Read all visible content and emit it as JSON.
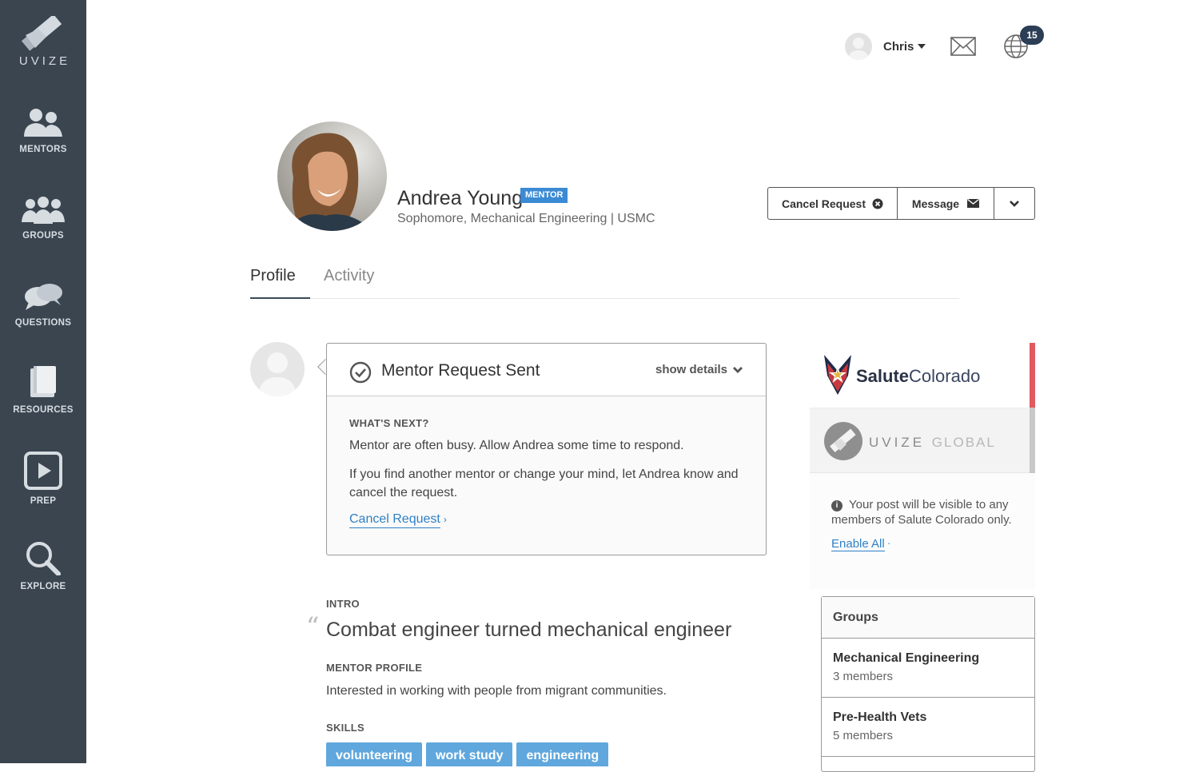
{
  "brand": {
    "logo_text": "UVIZE"
  },
  "nav": {
    "items": [
      {
        "label": "MENTORS",
        "icon": "mentors-icon"
      },
      {
        "label": "GROUPS",
        "icon": "groups-icon"
      },
      {
        "label": "QUESTIONS",
        "icon": "questions-icon"
      },
      {
        "label": "RESOURCES",
        "icon": "resources-icon"
      },
      {
        "label": "PREP",
        "icon": "prep-play-icon"
      },
      {
        "label": "EXPLORE",
        "icon": "search-icon"
      }
    ]
  },
  "topbar": {
    "user_name": "Chris",
    "notification_count": "15"
  },
  "profile": {
    "name": "Andrea Young",
    "role_badge": "MENTOR",
    "subtitle": "Sophomore, Mechanical Engineering | USMC",
    "actions": {
      "cancel": "Cancel Request",
      "message": "Message"
    }
  },
  "tabs": {
    "profile": "Profile",
    "activity": "Activity"
  },
  "request_card": {
    "title": "Mentor Request Sent",
    "toggle": "show details",
    "next_label": "WHAT'S NEXT?",
    "line1": "Mentor are often busy. Allow Andrea some time to respond.",
    "line2": "If you find another mentor or change your mind, let Andrea know and cancel the request.",
    "link": "Cancel Request"
  },
  "intro": {
    "label": "INTRO",
    "text": "Combat engineer turned mechanical engineer",
    "mentor_profile_label": "MENTOR PROFILE",
    "mentor_profile_text": "Interested in working with people from migrant communities.",
    "skills_label": "SKILLS",
    "skills": [
      "volunteering",
      "work study",
      "engineering"
    ]
  },
  "orgs": {
    "salute_bold": "Salute",
    "salute_rest": "Colorado",
    "uvize_main": "UVIZE",
    "uvize_global": "GLOBAL",
    "note": "Your post will be visible to any members of Salute Colorado only.",
    "enable_all": "Enable All"
  },
  "groups": {
    "title": "Groups",
    "items": [
      {
        "name": "Mechanical Engineering",
        "count": "3 members"
      },
      {
        "name": "Pre-Health Vets",
        "count": "5 members"
      }
    ]
  },
  "colors": {
    "sidebar": "#3a4550",
    "accent_blue": "#3b8ad4",
    "link": "#2f80c5",
    "skill_tag": "#5fa7dd",
    "salute_red": "#e05a5f"
  }
}
